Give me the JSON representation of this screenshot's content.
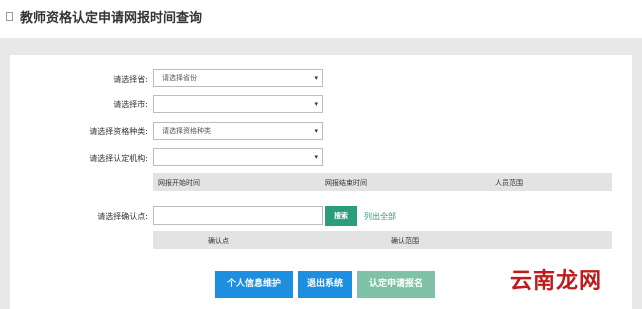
{
  "header": {
    "title": "教师资格认定申请网报时间查询"
  },
  "form": {
    "province_label": "请选择省:",
    "province_placeholder": "请选择省份",
    "city_label": "请选择市:",
    "city_value": "",
    "qualification_label": "请选择资格种类:",
    "qualification_placeholder": "请选择资格种类",
    "agency_label": "请选择认定机构:",
    "agency_value": "",
    "arrow": "▾"
  },
  "schedule_table": {
    "columns": [
      "网报开始时间",
      "网报结束时间",
      "人员范围"
    ]
  },
  "confirm": {
    "label": "请选择确认点:",
    "input_value": "",
    "search_button": "搜索",
    "list_all_link": "列出全部"
  },
  "confirm_table": {
    "columns": [
      "确认点",
      "确认范围"
    ]
  },
  "actions": {
    "personal_info_button": "个人信息维护",
    "logout_button": "退出系统",
    "apply_button": "认定申请报名"
  },
  "watermark": "云南龙网",
  "colors": {
    "primary_blue": "#1e8ee0",
    "teal": "#2a9d7c",
    "disabled_green": "#7fc2a8",
    "watermark_red": "#c01a1a"
  }
}
